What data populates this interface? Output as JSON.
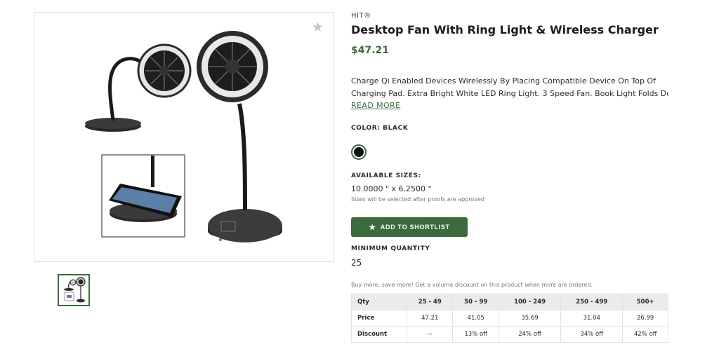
{
  "product": {
    "brand": "HIT®",
    "title": "Desktop Fan With Ring Light & Wireless Charger",
    "price": "$47.21",
    "description_lines": [
      "Charge Qi Enabled Devices Wirelessly By Placing Compatible Device On Top Of",
      "Charging Pad. Extra Bright White LED Ring Light. 3 Speed Fan. Book Light Folds Do..."
    ],
    "read_more": "READ MORE"
  },
  "color": {
    "label": "COLOR: BLACK",
    "swatch_hex": "#111111"
  },
  "sizes": {
    "label": "AVAILABLE SIZES:",
    "value": "10.0000 \" x 6.2500 \"",
    "note": "Sizes will be selected after proofs are approved"
  },
  "shortlist_button": "ADD TO SHORTLIST",
  "min_quantity": {
    "label": "MINIMUM QUANTITY",
    "value": "25"
  },
  "volume_note": "Buy more, save more! Get a volume discount on this product when more are ordered.",
  "pricing": {
    "header": [
      "Qty",
      "25 - 49",
      "50 - 99",
      "100 - 249",
      "250 - 499",
      "500+"
    ],
    "rows": [
      [
        "Price",
        "47.21",
        "41.05",
        "35.69",
        "31.04",
        "26.99"
      ],
      [
        "Discount",
        "--",
        "13% off",
        "24% off",
        "34% off",
        "42% off"
      ]
    ]
  },
  "colors": {
    "accent": "#3b6a3c",
    "border": "#dcdcdc"
  },
  "icons": {
    "favorite": "star-icon",
    "shortlist": "star-icon"
  }
}
